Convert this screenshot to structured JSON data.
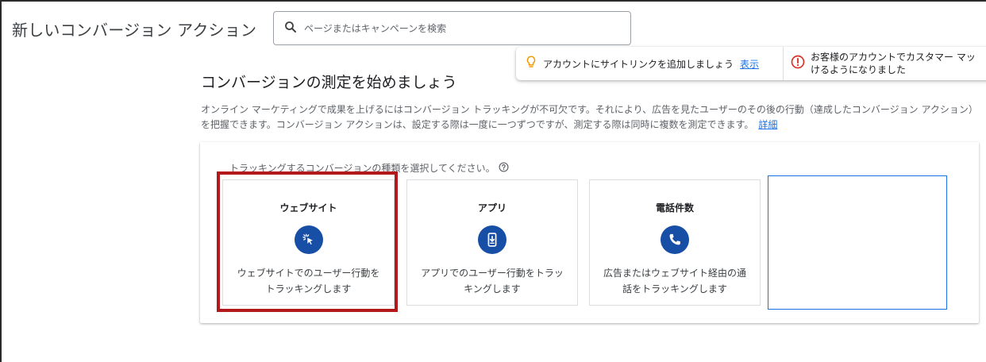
{
  "page": {
    "title": "新しいコンバージョン アクション"
  },
  "search": {
    "placeholder": "ページまたはキャンペーンを検索",
    "icon": "search-icon"
  },
  "notifications": {
    "sitelink": {
      "text": "アカウントにサイトリンクを追加しましょう",
      "link": "表示",
      "icon": "lightbulb-icon",
      "icon_color": "#f29900"
    },
    "customer": {
      "text": "お客様のアカウントでカスタマー マッ\nけるようになりました",
      "icon": "error-icon",
      "icon_color": "#d93025"
    }
  },
  "main": {
    "heading": "コンバージョンの測定を始めましょう",
    "description": "オンライン マーケティングで成果を上げるにはコンバージョン トラッキングが不可欠です。それにより、広告を見たユーザーのその後の行動（達成したコンバージョン アクション）を把握できます。コンバージョン アクションは、設定する際は一度に一つずつですが、測定する際は同時に複数を測定できます。",
    "learn_more": "詳細"
  },
  "panel": {
    "label": "トラッキングするコンバージョンの種類を選択してください。",
    "cards": [
      {
        "title": "ウェブサイト",
        "icon": "cursor-click-icon",
        "description": "ウェブサイトでのユーザー行動をトラッキングします"
      },
      {
        "title": "アプリ",
        "icon": "mobile-download-icon",
        "description": "アプリでのユーザー行動をトラッキングします"
      },
      {
        "title": "電話件数",
        "icon": "phone-icon",
        "description": "広告またはウェブサイト経由の通話をトラッキングします"
      }
    ]
  },
  "colors": {
    "accent": "#1a73e8",
    "icon_circle": "#174ea6",
    "highlight_box": "#b3191b"
  }
}
